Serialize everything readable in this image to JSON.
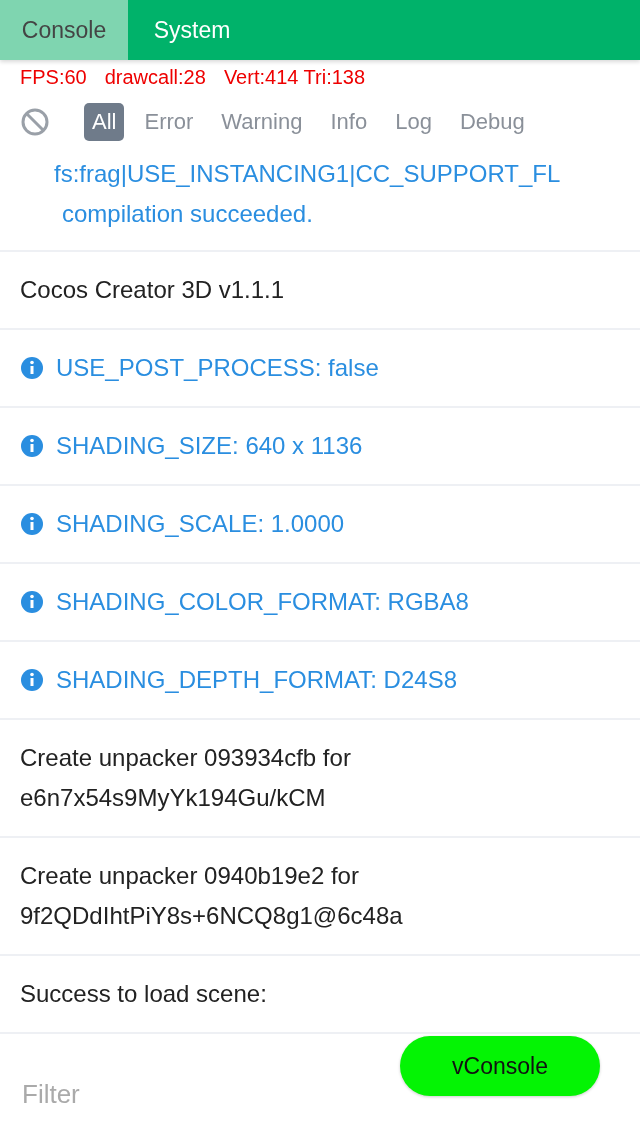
{
  "tabs": [
    {
      "label": "Console",
      "selected": true
    },
    {
      "label": "System",
      "selected": false
    }
  ],
  "stats": [
    "FPS:60",
    "drawcall:28",
    "Vert:414 Tri:138"
  ],
  "filters": [
    {
      "label": "All",
      "selected": true
    },
    {
      "label": "Error",
      "selected": false
    },
    {
      "label": "Warning",
      "selected": false
    },
    {
      "label": "Info",
      "selected": false
    },
    {
      "label": "Log",
      "selected": false
    },
    {
      "label": "Debug",
      "selected": false
    }
  ],
  "logs": [
    {
      "kind": "compile",
      "lines": [
        "fs:frag|USE_INSTANCING1|CC_SUPPORT_FL",
        "compilation succeeded."
      ]
    },
    {
      "kind": "log",
      "lines": [
        "Cocos Creator 3D v1.1.1"
      ]
    },
    {
      "kind": "info",
      "lines": [
        "USE_POST_PROCESS: false"
      ]
    },
    {
      "kind": "info",
      "lines": [
        "SHADING_SIZE: 640 x 1136"
      ]
    },
    {
      "kind": "info",
      "lines": [
        "SHADING_SCALE: 1.0000"
      ]
    },
    {
      "kind": "info",
      "lines": [
        "SHADING_COLOR_FORMAT: RGBA8"
      ]
    },
    {
      "kind": "info",
      "lines": [
        "SHADING_DEPTH_FORMAT: D24S8"
      ]
    },
    {
      "kind": "log",
      "lines": [
        "Create unpacker 093934cfb for",
        "e6n7x54s9MyYk194Gu/kCM"
      ]
    },
    {
      "kind": "log",
      "lines": [
        "Create unpacker 0940b19e2 for",
        "9f2QDdIhtPiY8s+6NCQ8g1@6c48a"
      ]
    },
    {
      "kind": "log",
      "lines": [
        "Success to load scene:"
      ]
    }
  ],
  "filter_field": {
    "placeholder": "Filter"
  },
  "toggle_button": "vConsole"
}
